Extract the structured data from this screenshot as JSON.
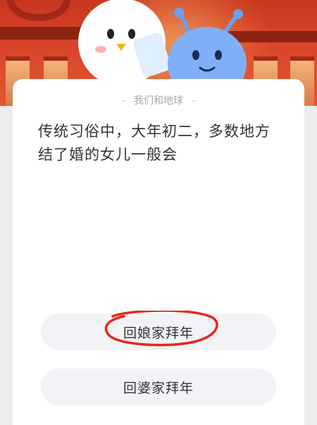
{
  "header": {
    "label": "我们和地球",
    "dash_left": "-",
    "dash_right": "-"
  },
  "question": {
    "text": "传统习俗中，大年初二，多数地方结了婚的女儿一般会"
  },
  "options": [
    {
      "label": "回娘家拜年",
      "circled": true
    },
    {
      "label": "回婆家拜年",
      "circled": false
    }
  ],
  "colors": {
    "banner": "#d9452a",
    "card": "#ffffff",
    "option_bg": "#f1f3f7",
    "annotation": "#e8281e"
  },
  "icons": {
    "mascot_left": "white-bird-mascot",
    "mascot_right": "blue-alien-mascot"
  }
}
